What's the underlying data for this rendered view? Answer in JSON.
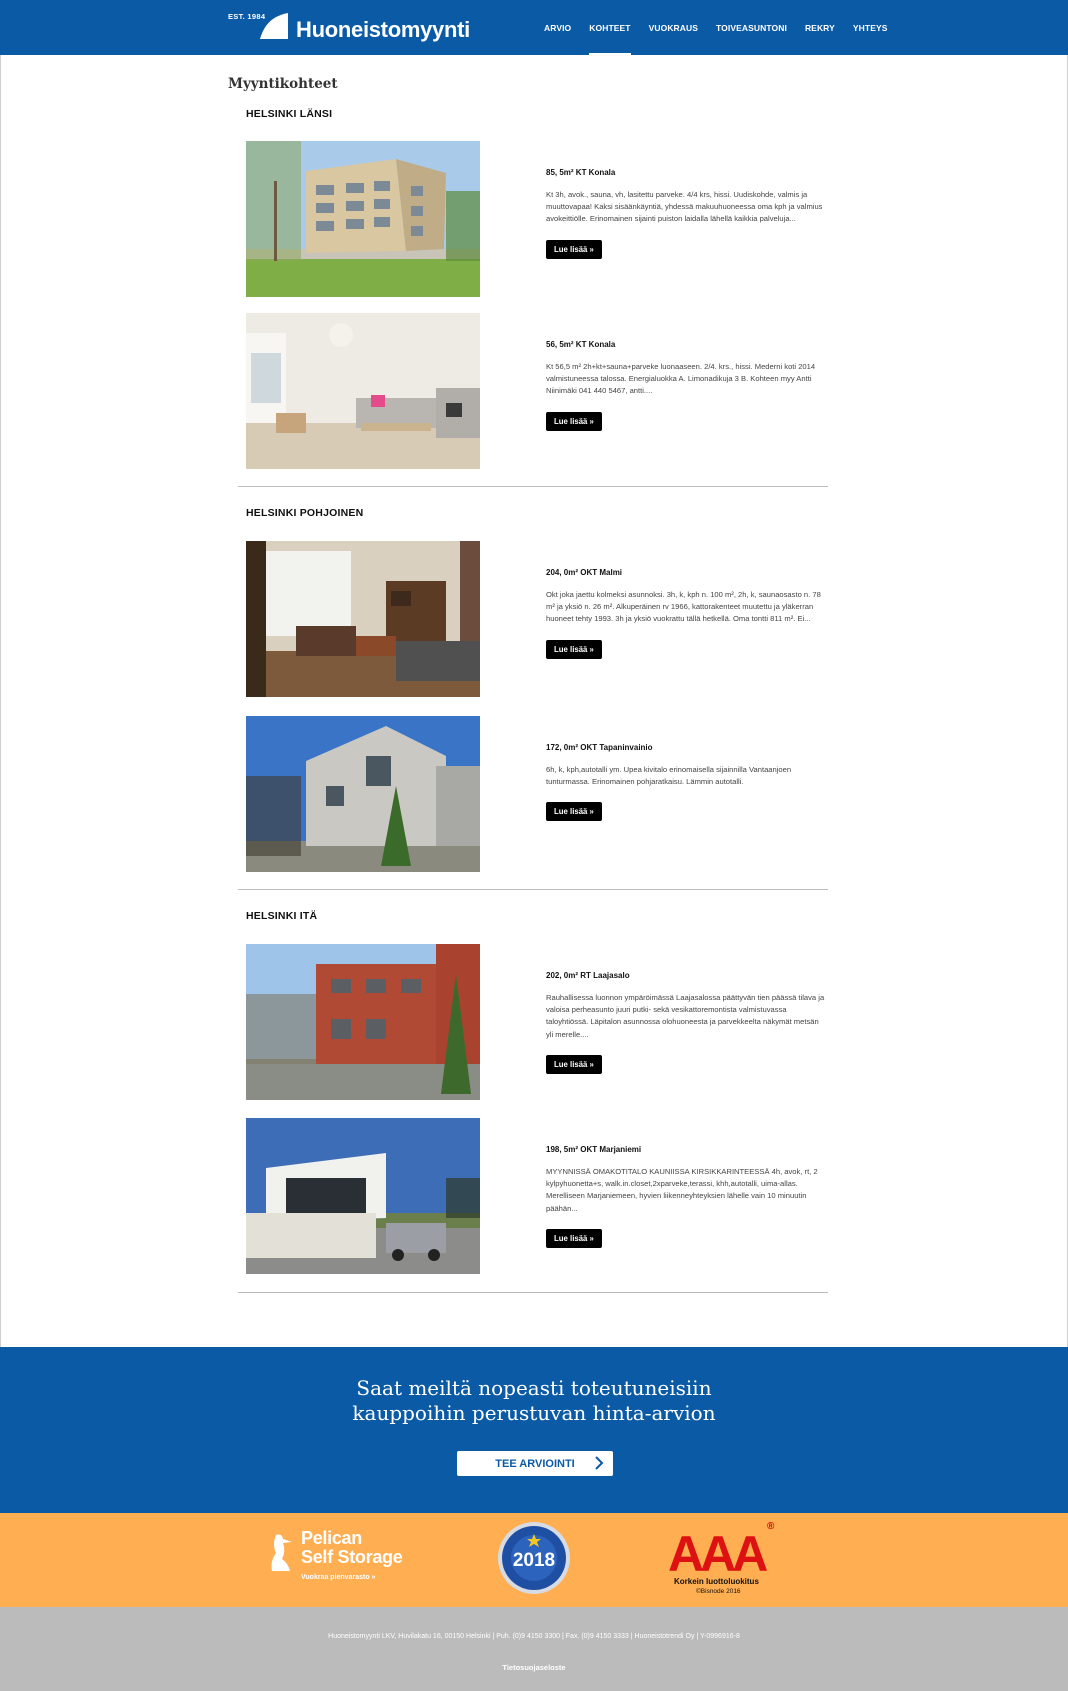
{
  "header": {
    "logo_est": "EST. 1984",
    "logo_name": "Huoneistomyynti",
    "nav": [
      "ARVIO",
      "KOHTEET",
      "VUOKRAUS",
      "TOIVEASUNTONI",
      "REKRY",
      "YHTEYS"
    ],
    "active_nav": "KOHTEET",
    "brand_color": "#0a5aa5"
  },
  "main": {
    "page_title": "Myyntikohteet",
    "regions": [
      {
        "name": "HELSINKI LÄNSI",
        "listings": [
          {
            "title": "85, 5m² KT Konala",
            "description": "Kt 3h, avok., sauna, vh, lasitettu parveke. 4/4 krs, hissi. Uudiskohde, valmis ja muuttovapaa! Kaksi sisäänkäyntiä, yhdessä makuuhuoneessa oma kph ja valmius avokeittiölle. Erinomainen sijainti puiston laidalla lähellä kaikkia palveluja...",
            "button": "Lue lisää »",
            "photo": "apartment-building"
          },
          {
            "title": "56, 5m² KT Konala",
            "description": "Kt 56,5 m² 2h+kt+sauna+parveke luonaaseen. 2/4. krs., hissi. Mederni koti 2014 valmistuneessa talossa. Energialuokka A. Limonadikuja 3 B. Kohteen myy Antti Niinimäki 041 440 5467, antti....",
            "button": "Lue lisää »",
            "photo": "living-room-white"
          }
        ]
      },
      {
        "name": "HELSINKI POHJOINEN",
        "listings": [
          {
            "title": "204, 0m² OKT Malmi",
            "description": "Okt joka jaettu kolmeksi asunnoksi. 3h, k, kph n. 100 m², 2h, k, saunaosasto n. 78 m² ja yksiö n. 26 m². Alkuperäinen rv 1966, kattorakenteet muutettu ja yläkerran huoneet tehty 1993. 3h ja yksiö vuokrattu tällä hetkellä. Oma tontti 811 m². Ei...",
            "button": "Lue lisää »",
            "photo": "living-room-brown"
          },
          {
            "title": "172, 0m² OKT Tapaninvainio",
            "description": "6h, k, kph,autotalli ym. Upea kivitalo erinomaisella sijainnilla Vantaanjoen tunturmassa. Erinomainen pohjaratkaisu. Lämmin autotalli.",
            "button": "Lue lisää »",
            "photo": "stone-house"
          }
        ]
      },
      {
        "name": "HELSINKI ITÄ",
        "listings": [
          {
            "title": "202, 0m² RT Laajasalo",
            "description": "Rauhallisessa luonnon ympäröimässä Laajasalossa päättyvän tien päässä tilava ja valoisa perheasunto juuri putki- sekä vesikattoremontista valmistuvassa taloyhtiössä. Läpitalon asunnossa olohuoneesta ja parvekkeelta näkymät metsän yli merelle....",
            "button": "Lue lisää »",
            "photo": "brick-rowhouse"
          },
          {
            "title": "198, 5m² OKT Marjaniemi",
            "description": "MYYNNISSÄ OMAKOTITALO KAUNIISSA KIRSIKKARINTEESSÄ 4h, avok, rt, 2 kylpyhuonetta+s, walk.in.closet,2xparveke,terassi, khh,autotalli, uima-allas. Merelliseen Marjaniemeen, hyvien liikenneyhteyksien lähelle vain 10 minuutin päähän...",
            "button": "Lue lisää »",
            "photo": "modern-villa"
          }
        ]
      }
    ]
  },
  "banner": {
    "line1": "Saat meiltä nopeasti toteutuneisiin",
    "line2": "kauppoihin perustuvan hinta-arvion",
    "cta": "TEE ARVIOINTI"
  },
  "partners": {
    "pelican_line1": "Pelican",
    "pelican_line2": "Self Storage",
    "pelican_sub": "Vuokraa pienvarasto »",
    "seal_year": "2018",
    "aaa_text": "AAA",
    "aaa_sub1": "Korkein luottoluokitus",
    "aaa_sub2": "©Bisnode 2016"
  },
  "footer": {
    "address": "Huoneistomyynti LKV, Huvilakatu 16, 00150 Helsinki | Puh. (0)9 4150 3300 | Fax. (0)9 4150 3333 | Huoneistotrendi Oy | Y-0996916-8",
    "privacy": "Tietosuojaseloste"
  }
}
